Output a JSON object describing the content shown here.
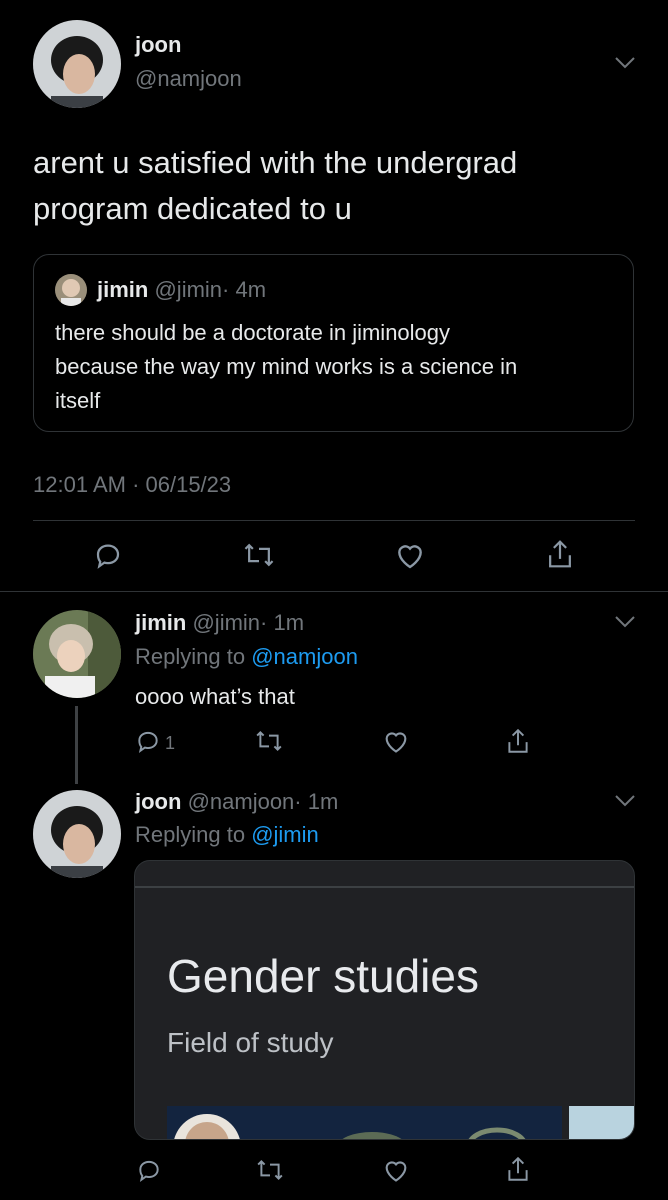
{
  "main_tweet": {
    "display_name": "joon",
    "handle": "@namjoon",
    "text_line1": "arent u satisfied with the undergrad",
    "text_line2": "program dedicated to u",
    "quote": {
      "display_name": "jimin",
      "handle": "@jimin",
      "separator": "·",
      "time": "4m",
      "text_line1": "there should be a doctorate in jiminology",
      "text_line2": "because the way my mind works is a science in",
      "text_line3": "itself"
    },
    "timestamp": "12:01 AM · 06/15/23"
  },
  "reply1": {
    "display_name": "jimin",
    "handle": "@jimin",
    "separator": "·",
    "time": "1m",
    "replying_prefix": "Replying to",
    "replying_to": "@namjoon",
    "text": "oooo what’s that",
    "reply_count": "1"
  },
  "reply2": {
    "display_name": "joon",
    "handle": "@namjoon",
    "separator": "·",
    "time": "1m",
    "replying_prefix": "Replying to",
    "replying_to": "@jimin",
    "card": {
      "title": "Gender studies",
      "subtitle": "Field of study"
    }
  },
  "colors": {
    "background": "#000000",
    "text": "#e7e9ea",
    "muted": "#71767b",
    "link": "#1d9bf0",
    "border": "#2f3336"
  },
  "icons": [
    "chevron-down-icon",
    "reply-icon",
    "retweet-icon",
    "like-icon",
    "share-icon"
  ]
}
